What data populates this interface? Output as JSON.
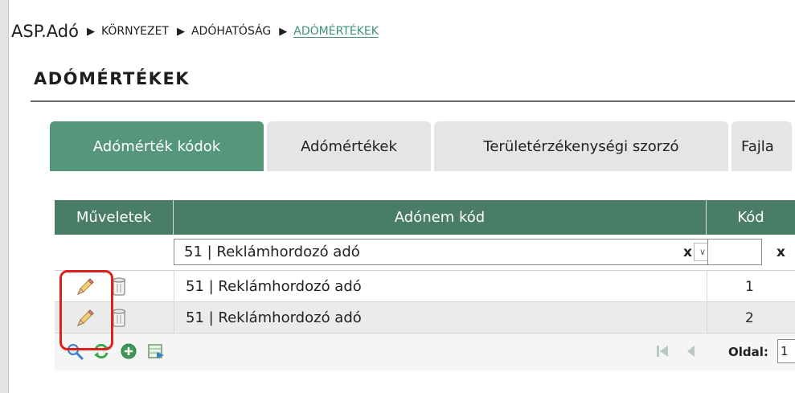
{
  "breadcrumb": {
    "root": "ASP.Adó",
    "items": [
      "KÖRNYEZET",
      "ADÓHATÓSÁG"
    ],
    "active": "ADÓMÉRTÉKEK"
  },
  "page_title": "ADÓMÉRTÉKEK",
  "tabs": [
    {
      "label": "Adómérték kódok",
      "active": true
    },
    {
      "label": "Adómértékek",
      "active": false
    },
    {
      "label": "Területérzékenységi szorzó",
      "active": false
    },
    {
      "label": "Fajla",
      "active": false
    }
  ],
  "table": {
    "columns": [
      "Műveletek",
      "Adónem kód",
      "Kód"
    ],
    "filter": {
      "adonem_value": "51 | Reklámhordozó adó",
      "clear_label": "x",
      "kod_value": ""
    },
    "rows": [
      {
        "adonem": "51 | Reklámhordozó adó",
        "kod": "1"
      },
      {
        "adonem": "51 | Reklámhordozó adó",
        "kod": "2"
      }
    ]
  },
  "footer": {
    "icons": [
      "search-icon",
      "refresh-icon",
      "add-icon",
      "export-icon"
    ],
    "pager_label": "Oldal:",
    "page_value": "1"
  },
  "colors": {
    "accent": "#56967b",
    "header": "#4a7d66",
    "highlight": "#e0201c"
  }
}
